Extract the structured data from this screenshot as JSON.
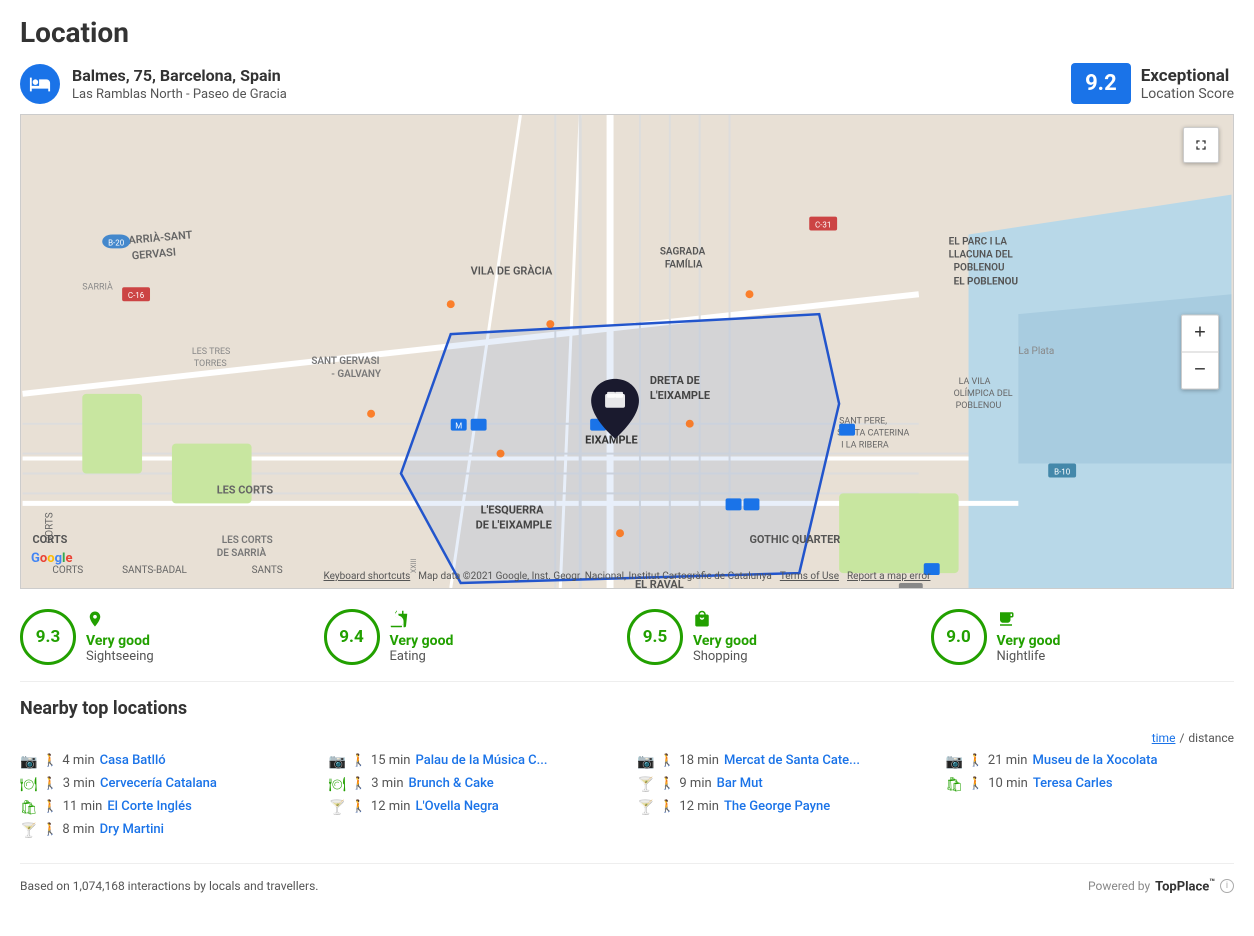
{
  "page": {
    "title": "Location"
  },
  "header": {
    "address_main": "Balmes, 75, Barcelona, Spain",
    "address_sub": "Las Ramblas North - Paseo de Gracia",
    "score_number": "9.2",
    "score_label_top": "Exceptional",
    "score_label_bot": "Location Score"
  },
  "map": {
    "attribution": "Keyboard shortcuts    Map data ©2021 Google, Inst. Geogr. Nacional, Institut Cartogràfic de Catalunya    Terms of Use    Report a map error",
    "google_label": "Google",
    "zoom_in": "+",
    "zoom_out": "−"
  },
  "scores": [
    {
      "value": "9.3",
      "rating": "Very good",
      "category": "Sightseeing",
      "icon": "📷"
    },
    {
      "value": "9.4",
      "rating": "Very good",
      "category": "Eating",
      "icon": "🍽"
    },
    {
      "value": "9.5",
      "rating": "Very good",
      "category": "Shopping",
      "icon": "🛍"
    },
    {
      "value": "9.0",
      "rating": "Very good",
      "category": "Nightlife",
      "icon": "🍸"
    }
  ],
  "nearby": {
    "title": "Nearby top locations",
    "controls": {
      "time_label": "time",
      "sep": "/",
      "distance_label": "distance"
    },
    "columns": [
      [
        {
          "cat_icon": "📷",
          "walk_time": "4 min",
          "name": "Casa Batlló"
        },
        {
          "cat_icon": "🍽",
          "walk_time": "3 min",
          "name": "Cervecería Catalana"
        },
        {
          "cat_icon": "🛍",
          "walk_time": "11 min",
          "name": "El Corte Inglés"
        },
        {
          "cat_icon": "🍸",
          "walk_time": "8 min",
          "name": "Dry Martini"
        }
      ],
      [
        {
          "cat_icon": "📷",
          "walk_time": "15 min",
          "name": "Palau de la Música C..."
        },
        {
          "cat_icon": "🍽",
          "walk_time": "3 min",
          "name": "Brunch & Cake"
        },
        {
          "cat_icon": "",
          "walk_time": "12 min",
          "name": "L'Ovella Negra"
        }
      ],
      [
        {
          "cat_icon": "📷",
          "walk_time": "18 min",
          "name": "Mercat de Santa Cate..."
        },
        {
          "cat_icon": "🍸",
          "walk_time": "9 min",
          "name": "Bar Mut"
        },
        {
          "cat_icon": "",
          "walk_time": "12 min",
          "name": "The George Payne"
        }
      ],
      [
        {
          "cat_icon": "📷",
          "walk_time": "21 min",
          "name": "Museu de la Xocolata"
        },
        {
          "cat_icon": "🛍",
          "walk_time": "10 min",
          "name": "Teresa Carles"
        }
      ]
    ]
  },
  "footer": {
    "text": "Based on 1,074,168 interactions by locals and travellers.",
    "powered_by": "Powered by",
    "brand": "TopPlace™",
    "info": "ℹ"
  }
}
